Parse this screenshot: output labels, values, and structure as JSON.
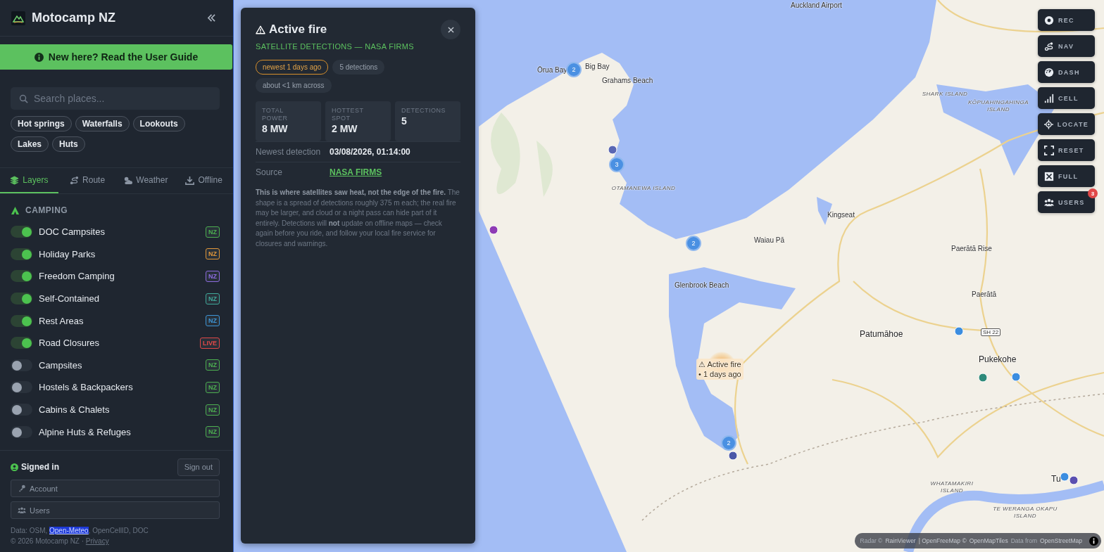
{
  "app": {
    "title": "Motocamp NZ"
  },
  "guide_banner": {
    "text": "New here? Read the User Guide"
  },
  "search": {
    "placeholder": "Search places..."
  },
  "quick_filters": [
    "Hot springs",
    "Waterfalls",
    "Lookouts",
    "Lakes",
    "Huts"
  ],
  "tabs": [
    {
      "label": "Layers",
      "selected": true
    },
    {
      "label": "Route",
      "selected": false
    },
    {
      "label": "Weather",
      "selected": false
    },
    {
      "label": "Offline",
      "selected": false
    }
  ],
  "section": {
    "title": "CAMPING"
  },
  "layers": [
    {
      "name": "DOC Campsites",
      "on": true,
      "badge": "NZ",
      "color": "#4caf50"
    },
    {
      "name": "Holiday Parks",
      "on": true,
      "badge": "NZ",
      "color": "#e0963a"
    },
    {
      "name": "Freedom Camping",
      "on": true,
      "badge": "NZ",
      "color": "#8c6be0"
    },
    {
      "name": "Self-Contained",
      "on": true,
      "badge": "NZ",
      "color": "#3fa89a"
    },
    {
      "name": "Rest Areas",
      "on": true,
      "badge": "NZ",
      "color": "#3d95d6"
    },
    {
      "name": "Road Closures",
      "on": true,
      "badge": "LIVE",
      "color": "#e04848"
    },
    {
      "name": "Campsites",
      "on": false,
      "badge": "NZ",
      "color": "#4caf50"
    },
    {
      "name": "Hostels & Backpackers",
      "on": false,
      "badge": "NZ",
      "color": "#4caf50"
    },
    {
      "name": "Cabins & Chalets",
      "on": false,
      "badge": "NZ",
      "color": "#4caf50"
    },
    {
      "name": "Alpine Huts & Refuges",
      "on": false,
      "badge": "NZ",
      "color": "#4caf50"
    }
  ],
  "account": {
    "status": "Signed in",
    "sign_out": "Sign out",
    "account_button": "Account",
    "users_button": "Users"
  },
  "footer": {
    "data_prefix": "Data: OSM, ",
    "data_link": "Open-Meteo",
    "data_suffix": ", OpenCellID, DOC",
    "copyright": "© 2026 Motocamp NZ · ",
    "privacy": "Privacy"
  },
  "fire_panel": {
    "title": "Active fire",
    "subtitle": "SATELLITE DETECTIONS — NASA FIRMS",
    "chips": [
      {
        "text": "newest 1 days ago",
        "kind": "highlight"
      },
      {
        "text": "5 detections",
        "kind": "plain"
      },
      {
        "text": "about <1 km across",
        "kind": "plain"
      }
    ],
    "stats": [
      {
        "label": "TOTAL POWER",
        "value": "8 MW"
      },
      {
        "label": "HOTTEST SPOT",
        "value": "2 MW"
      },
      {
        "label": "DETECTIONS",
        "value": "5"
      }
    ],
    "details": [
      {
        "label": "Newest detection",
        "value": "03/08/2026, 01:14:00",
        "kind": "text"
      },
      {
        "label": "Source",
        "value": "NASA FIRMS",
        "kind": "link"
      }
    ],
    "note": "**This is where satellites saw heat, not the edge of the fire.** The shape is a spread of detections roughly 375 m each; the real fire may be larger, and cloud or a night pass can hide part of it entirely. Detections will **not** update on offline maps — check again before you ride, and follow your local fire service for closures and warnings."
  },
  "map": {
    "labels": [
      {
        "text": "Auckland Airport",
        "kind": "place"
      },
      {
        "text": "Ōrua Bay",
        "kind": "place"
      },
      {
        "text": "Big Bay",
        "kind": "place"
      },
      {
        "text": "Grahams Beach",
        "kind": "place"
      },
      {
        "text": "OTAMANEWA ISLAND",
        "kind": "island"
      },
      {
        "text": "SHARK ISLAND",
        "kind": "island"
      },
      {
        "text": "KŌPUAHINGAHINGA ISLAND",
        "kind": "island"
      },
      {
        "text": "Kingseat",
        "kind": "place"
      },
      {
        "text": "Waiau Pā",
        "kind": "place"
      },
      {
        "text": "Paerātā Rise",
        "kind": "place"
      },
      {
        "text": "Glenbrook Beach",
        "kind": "place"
      },
      {
        "text": "Paerātā",
        "kind": "place"
      },
      {
        "text": "Patumāhoe",
        "kind": "town"
      },
      {
        "text": "SH 22",
        "kind": "road"
      },
      {
        "text": "Pukekohe",
        "kind": "town"
      },
      {
        "text": "WHATAMAKIRI ISLAND",
        "kind": "island"
      },
      {
        "text": "TE WERANGA OKAPU ISLAND",
        "kind": "island"
      },
      {
        "text": "Tu",
        "kind": "town"
      }
    ],
    "clusters": [
      "2",
      "3",
      "2",
      "2"
    ],
    "points": [
      {
        "color": "#5a67b3"
      },
      {
        "color": "#8e3bb5"
      },
      {
        "color": "#3b8de0"
      },
      {
        "color": "#2e8a7a"
      },
      {
        "color": "#3b8de0"
      },
      {
        "color": "#4a57a8"
      },
      {
        "color": "#3b8de0"
      },
      {
        "color": "#5a4fb0"
      }
    ],
    "fire": {
      "line1": "⚠ Active fire",
      "line2": "• 1 days ago"
    }
  },
  "map_controls": [
    {
      "label": "REC"
    },
    {
      "label": "NAV"
    },
    {
      "label": "DASH"
    },
    {
      "label": "CELL"
    },
    {
      "label": "LOCATE"
    },
    {
      "label": "RESET"
    },
    {
      "label": "FULL"
    },
    {
      "label": "USERS",
      "badge": "3"
    }
  ],
  "attribution": [
    {
      "text": "Radar ©",
      "kind": "dim"
    },
    {
      "text": "RainViewer",
      "kind": "link"
    },
    {
      "text": "| OpenFreeMap ©",
      "kind": "link"
    },
    {
      "text": "OpenMapTiles",
      "kind": "link"
    },
    {
      "text": "Data from",
      "kind": "dim"
    },
    {
      "text": "OpenStreetMap",
      "kind": "link"
    }
  ]
}
